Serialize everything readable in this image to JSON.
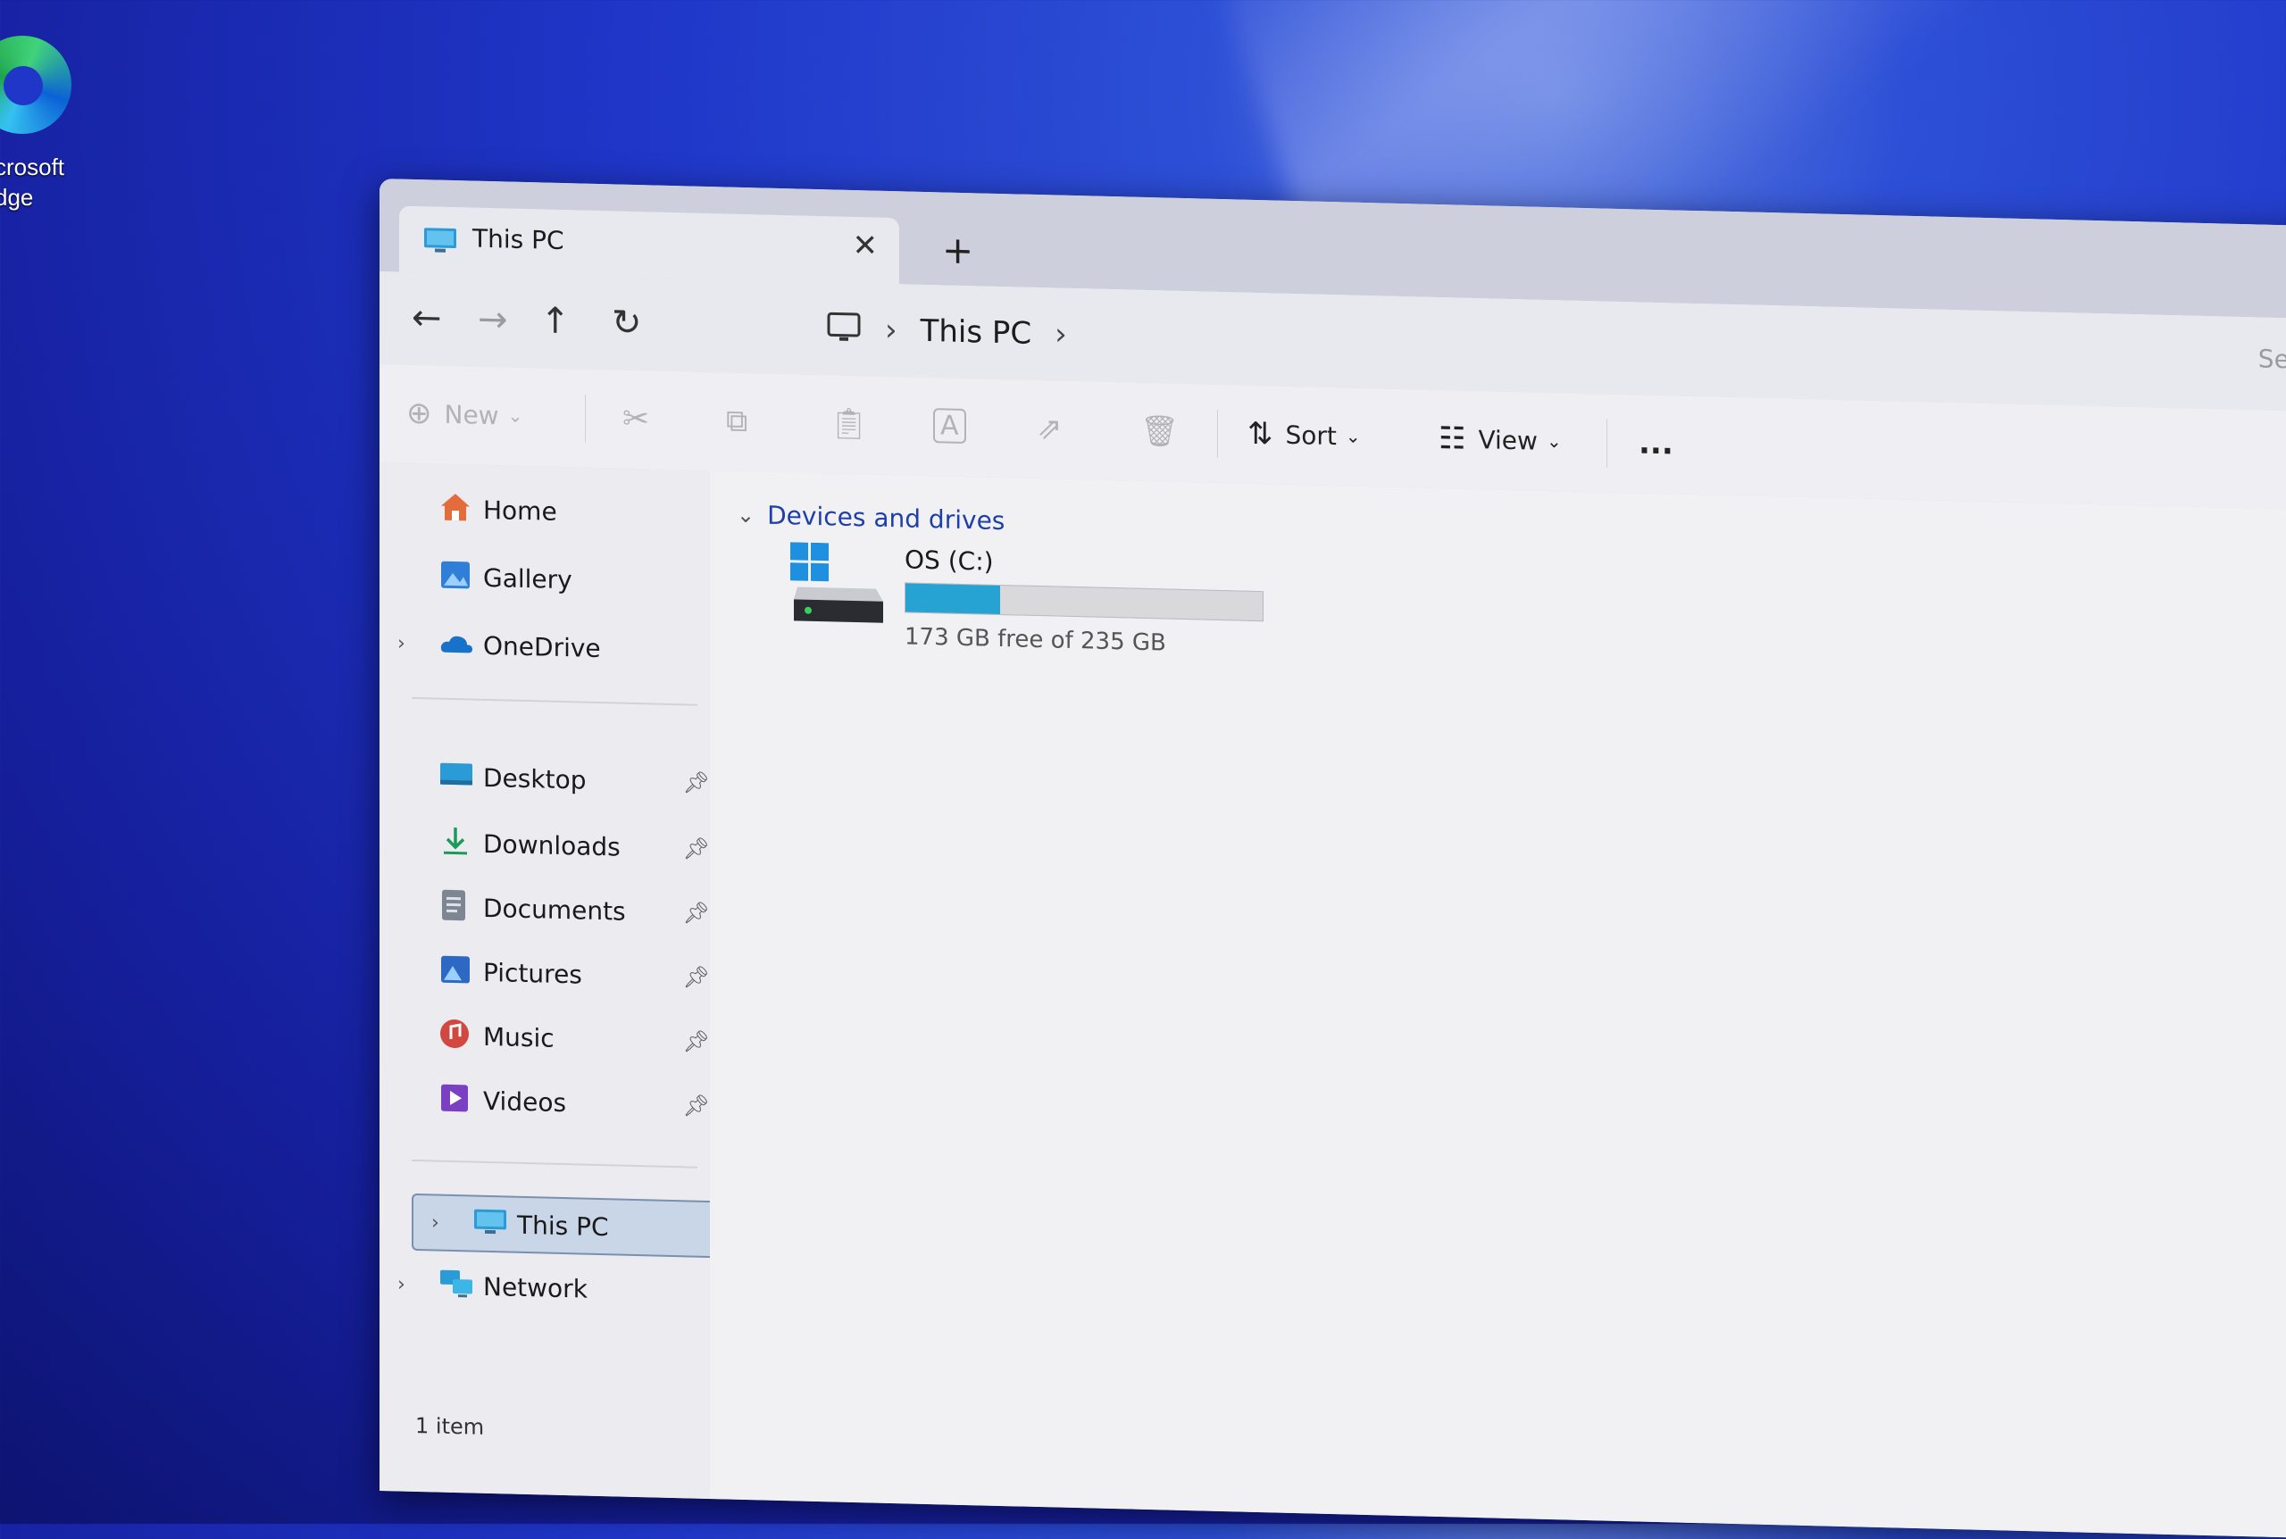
{
  "desktop": {
    "edge_label_line1": "crosoft",
    "edge_label_line2": "dge"
  },
  "tab": {
    "title": "This PC",
    "close": "✕",
    "new_tab": "+"
  },
  "nav": {
    "back": "←",
    "forward": "→",
    "up": "↑",
    "refresh": "↻",
    "breadcrumb": [
      "This PC"
    ],
    "separator": "›",
    "search_placeholder": "Search"
  },
  "toolbar": {
    "new_label": "New",
    "sort_label": "Sort",
    "view_label": "View",
    "more": "..."
  },
  "sidebar": {
    "top": [
      {
        "label": "Home",
        "icon": "home-icon"
      },
      {
        "label": "Gallery",
        "icon": "gallery-icon"
      },
      {
        "label": "OneDrive",
        "icon": "onedrive-icon",
        "expandable": true
      }
    ],
    "pinned": [
      {
        "label": "Desktop",
        "icon": "desktop-folder-icon"
      },
      {
        "label": "Downloads",
        "icon": "downloads-icon"
      },
      {
        "label": "Documents",
        "icon": "documents-icon"
      },
      {
        "label": "Pictures",
        "icon": "pictures-icon"
      },
      {
        "label": "Music",
        "icon": "music-icon"
      },
      {
        "label": "Videos",
        "icon": "videos-icon"
      }
    ],
    "bottom": [
      {
        "label": "This PC",
        "icon": "this-pc-icon",
        "selected": true
      },
      {
        "label": "Network",
        "icon": "network-icon"
      }
    ]
  },
  "content": {
    "section_title": "Devices and drives",
    "drive": {
      "name": "OS (C:)",
      "free_text": "173 GB free of 235 GB",
      "used_fraction": 0.264
    }
  },
  "status": {
    "item_count": "1 item"
  },
  "colors": {
    "accent": "#27a3d3",
    "section_text": "#1f3fa8",
    "selection": "#c9d6e8"
  }
}
